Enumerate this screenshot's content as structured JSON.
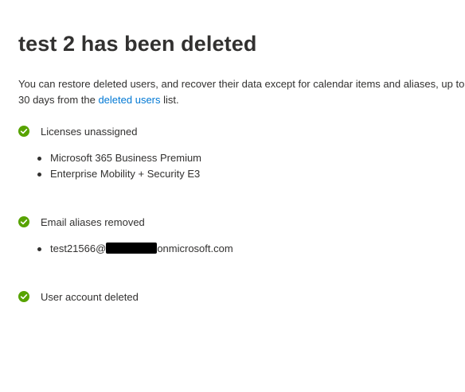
{
  "title": "test 2 has been deleted",
  "description": {
    "text_before": "You can restore deleted users, and recover their data except for calendar items and aliases, up to 30 days from the ",
    "link": "deleted users",
    "text_after": " list."
  },
  "sections": [
    {
      "label": "Licenses unassigned",
      "status": "success",
      "items": [
        "Microsoft 365 Business Premium",
        "Enterprise Mobility + Security E3"
      ]
    },
    {
      "label": "Email aliases removed",
      "status": "success",
      "items": [
        {
          "prefix": "test21566@",
          "redacted": true,
          "suffix": "onmicrosoft.com"
        }
      ]
    },
    {
      "label": "User account deleted",
      "status": "success",
      "items": []
    }
  ],
  "colors": {
    "success": "#57a300",
    "link": "#0078d4",
    "text": "#323130"
  }
}
